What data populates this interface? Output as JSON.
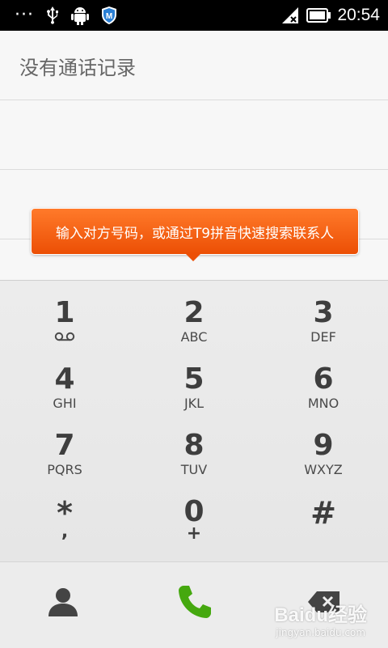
{
  "statusbar": {
    "dots": "···",
    "time": "20:54"
  },
  "calllog": {
    "empty_text": "没有通话记录"
  },
  "tooltip": {
    "text": "输入对方号码，或通过T9拼音快速搜索联系人"
  },
  "keypad": {
    "keys": [
      {
        "digit": "1",
        "letters": ""
      },
      {
        "digit": "2",
        "letters": "ABC"
      },
      {
        "digit": "3",
        "letters": "DEF"
      },
      {
        "digit": "4",
        "letters": "GHI"
      },
      {
        "digit": "5",
        "letters": "JKL"
      },
      {
        "digit": "6",
        "letters": "MNO"
      },
      {
        "digit": "7",
        "letters": "PQRS"
      },
      {
        "digit": "8",
        "letters": "TUV"
      },
      {
        "digit": "9",
        "letters": "WXYZ"
      },
      {
        "digit": "*",
        "letters": ","
      },
      {
        "digit": "0",
        "letters": "+"
      },
      {
        "digit": "#",
        "letters": ""
      }
    ]
  },
  "watermark": {
    "main": "Baidu经验",
    "sub": "jingyan.baidu.com"
  },
  "colors": {
    "accent_orange": "#ec4f05",
    "call_green": "#45a80f",
    "key_text": "#3e3e3e"
  }
}
